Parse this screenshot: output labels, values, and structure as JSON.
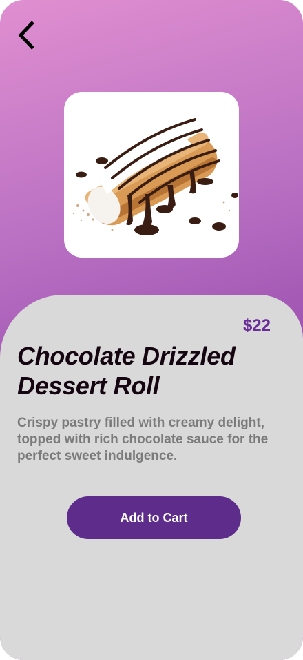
{
  "navigation": {
    "back_icon": "chevron-left-icon"
  },
  "product": {
    "image_icon": "dessert-roll-image",
    "price": "$22",
    "title": "Chocolate Drizzled Dessert Roll",
    "description": "Crispy pastry filled with creamy delight, topped with rich chocolate sauce for the perfect sweet indulgence."
  },
  "actions": {
    "add_to_cart_label": "Add to Cart"
  },
  "colors": {
    "accent": "#5e2d8b",
    "price": "#6a2c99",
    "panel": "#d9d9d9",
    "gradient_top": "#e08fd0",
    "gradient_bottom": "#8d3fa5"
  }
}
